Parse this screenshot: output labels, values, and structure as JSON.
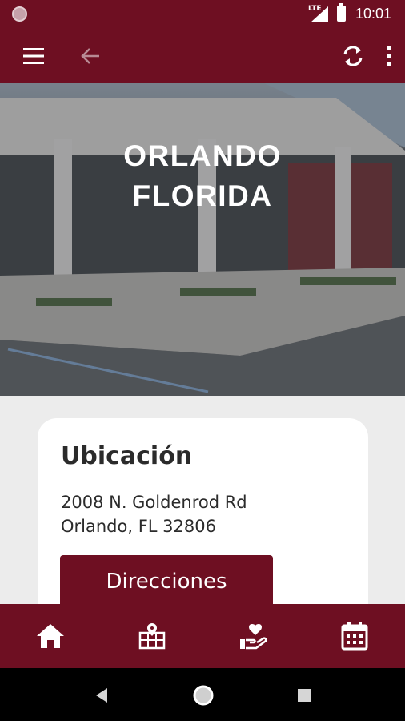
{
  "status_bar": {
    "network": "LTE",
    "time": "10:01"
  },
  "app_bar": {
    "icons": [
      "menu-icon",
      "back-arrow-icon",
      "refresh-icon",
      "more-vert-icon"
    ]
  },
  "hero": {
    "title_line1": "ORLANDO",
    "title_line2": "FLORIDA"
  },
  "location_card": {
    "title": "Ubicación",
    "address_line1": "2008 N. Goldenrod Rd",
    "address_line2": "Orlando, FL 32806",
    "button_label": "Direcciones"
  },
  "bottom_nav": {
    "items": [
      "home-icon",
      "map-icon",
      "give-icon",
      "calendar-icon"
    ]
  },
  "system_nav": {
    "items": [
      "back-icon",
      "home-icon",
      "recents-icon"
    ]
  },
  "colors": {
    "brand": "#6e0f22",
    "background": "#ececec",
    "card": "#ffffff",
    "text": "#2b2b2b"
  }
}
